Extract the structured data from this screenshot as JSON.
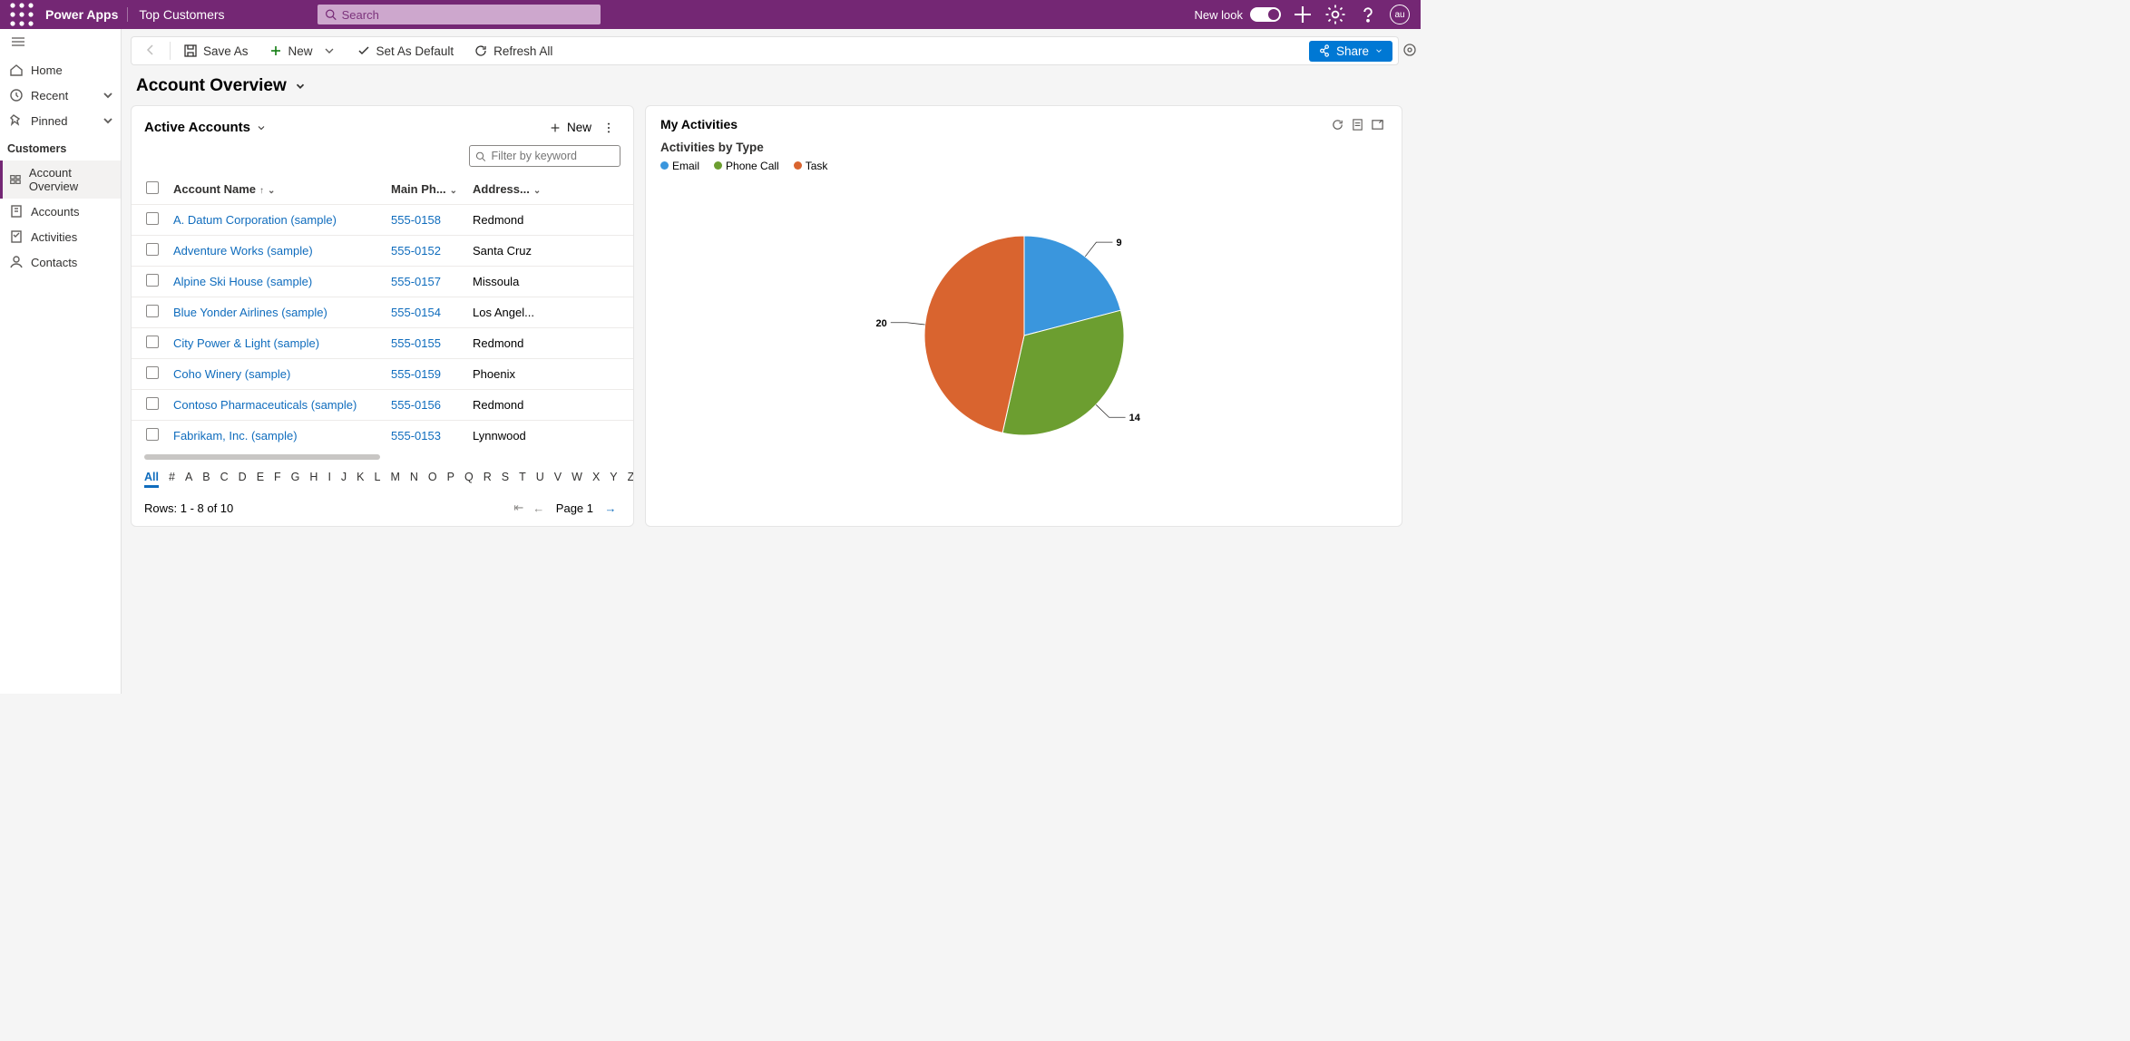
{
  "header": {
    "brand": "Power Apps",
    "page": "Top Customers",
    "search_placeholder": "Search",
    "new_look": "New look",
    "avatar": "au"
  },
  "sidebar": {
    "home": "Home",
    "recent": "Recent",
    "pinned": "Pinned",
    "group": "Customers",
    "items": [
      "Account Overview",
      "Accounts",
      "Activities",
      "Contacts"
    ]
  },
  "commands": {
    "save_as": "Save As",
    "new": "New",
    "set_default": "Set As Default",
    "refresh_all": "Refresh All",
    "share": "Share"
  },
  "title": "Account Overview",
  "accounts": {
    "title": "Active Accounts",
    "new": "New",
    "filter_placeholder": "Filter by keyword",
    "cols": [
      "Account Name",
      "Main Ph...",
      "Address..."
    ],
    "rows": [
      {
        "name": "A. Datum Corporation (sample)",
        "phone": "555-0158",
        "city": "Redmond"
      },
      {
        "name": "Adventure Works (sample)",
        "phone": "555-0152",
        "city": "Santa Cruz"
      },
      {
        "name": "Alpine Ski House (sample)",
        "phone": "555-0157",
        "city": "Missoula"
      },
      {
        "name": "Blue Yonder Airlines (sample)",
        "phone": "555-0154",
        "city": "Los Angel..."
      },
      {
        "name": "City Power & Light (sample)",
        "phone": "555-0155",
        "city": "Redmond"
      },
      {
        "name": "Coho Winery (sample)",
        "phone": "555-0159",
        "city": "Phoenix"
      },
      {
        "name": "Contoso Pharmaceuticals (sample)",
        "phone": "555-0156",
        "city": "Redmond"
      },
      {
        "name": "Fabrikam, Inc. (sample)",
        "phone": "555-0153",
        "city": "Lynnwood"
      }
    ],
    "alpha_all": "All",
    "alpha_hash": "#",
    "alpha": [
      "A",
      "B",
      "C",
      "D",
      "E",
      "F",
      "G",
      "H",
      "I",
      "J",
      "K",
      "L",
      "M",
      "N",
      "O",
      "P",
      "Q",
      "R",
      "S",
      "T",
      "U",
      "V",
      "W",
      "X",
      "Y",
      "Z"
    ],
    "rows_label": "Rows: 1 - 8 of 10",
    "page_label": "Page 1"
  },
  "activities": {
    "title": "My Activities",
    "subtitle": "Activities by Type",
    "legend": [
      {
        "label": "Email",
        "color": "#3a96dd"
      },
      {
        "label": "Phone Call",
        "color": "#6c9e30"
      },
      {
        "label": "Task",
        "color": "#d9642f"
      }
    ]
  },
  "chart_data": {
    "type": "pie",
    "title": "Activities by Type",
    "series": [
      {
        "name": "Email",
        "value": 9,
        "color": "#3a96dd"
      },
      {
        "name": "Phone Call",
        "value": 14,
        "color": "#6c9e30"
      },
      {
        "name": "Task",
        "value": 20,
        "color": "#d9642f"
      }
    ]
  }
}
